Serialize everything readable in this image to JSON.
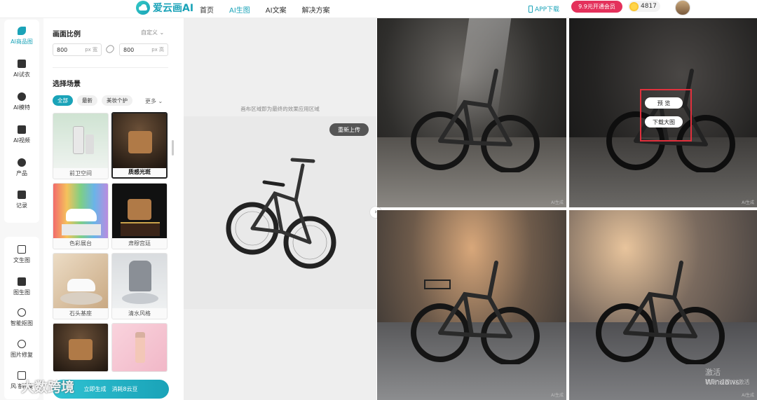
{
  "header": {
    "logo_text": "爱云画AI",
    "nav": [
      "首页",
      "AI生图",
      "AI文案",
      "解决方案"
    ],
    "active_nav": "AI生图",
    "app_download": "APP下载",
    "vip_button": "9.9元开通会员",
    "coins": "4817"
  },
  "sidebar": {
    "top_items": [
      {
        "label": "AI商品图",
        "icon": "brush-icon"
      },
      {
        "label": "AI试衣",
        "icon": "hanger-icon"
      },
      {
        "label": "AI模特",
        "icon": "model-icon"
      },
      {
        "label": "AI视频",
        "icon": "video-icon"
      },
      {
        "label": "产品",
        "icon": "product-icon"
      },
      {
        "label": "记录",
        "icon": "record-icon"
      }
    ],
    "tool_items": [
      {
        "label": "文生图",
        "icon": "text-to-image-icon"
      },
      {
        "label": "图生图",
        "icon": "image-to-image-icon"
      },
      {
        "label": "智能抠图",
        "icon": "cutout-icon"
      },
      {
        "label": "图片修复",
        "icon": "repair-icon"
      },
      {
        "label": "风格转换",
        "icon": "style-icon"
      }
    ]
  },
  "panel": {
    "ratio_title": "画面比例",
    "ratio_mode": "自定义",
    "width_value": "800",
    "width_unit": "px 宽",
    "height_value": "800",
    "height_unit": "px 高",
    "scene_title": "选择场景",
    "tabs": [
      "全部",
      "最新",
      "美妆个护"
    ],
    "more": "更多",
    "scenes": [
      {
        "label": "前卫空间"
      },
      {
        "label": "质感光斑"
      },
      {
        "label": "色彩展台"
      },
      {
        "label": "肃穆宫廷"
      },
      {
        "label": "石头基座"
      },
      {
        "label": "清水风格"
      },
      {
        "label": ""
      },
      {
        "label": ""
      }
    ],
    "generate_label": "立即生成",
    "generate_cost": "消耗8云豆"
  },
  "canvas": {
    "tip": "画布区域即为最终的效果应用区域",
    "reupload": "重新上传"
  },
  "results": {
    "ai_tag": "AI生成",
    "preview_button": "预 览",
    "download_button": "下载大图"
  },
  "watermark": "大数跨境",
  "windows_mark": "激活 Windows",
  "windows_mark_sub": "转到\"设置\"以激活"
}
